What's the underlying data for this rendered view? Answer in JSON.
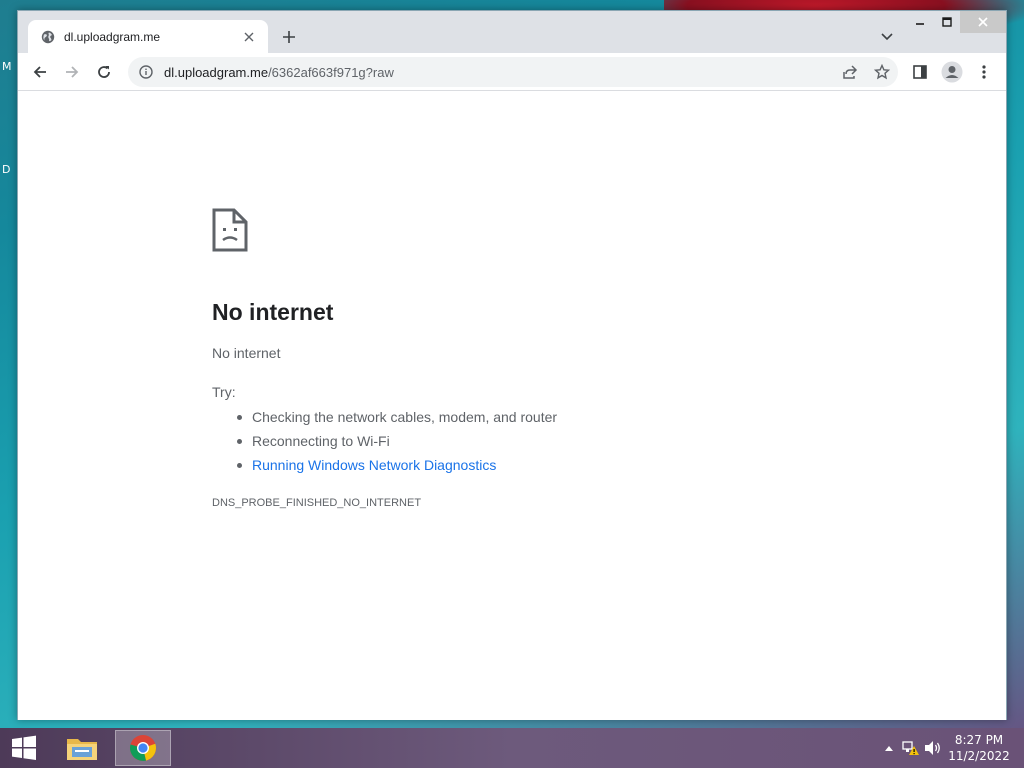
{
  "desktop": {
    "edge_text_1": "M",
    "edge_text_2": "D"
  },
  "window": {
    "controls": {
      "minimize": "—",
      "maximize": "☐",
      "close": "✕"
    }
  },
  "tabs": [
    {
      "title": "dl.uploadgram.me",
      "favicon": "globe-icon",
      "active": true
    }
  ],
  "toolbar": {
    "url_host": "dl.uploadgram.me",
    "url_path": "/6362af663f971g?raw"
  },
  "error_page": {
    "title": "No internet",
    "subtitle": "No internet",
    "try_label": "Try:",
    "suggestions": [
      "Checking the network cables, modem, and router",
      "Reconnecting to Wi-Fi",
      "Running Windows Network Diagnostics"
    ],
    "error_code": "DNS_PROBE_FINISHED_NO_INTERNET"
  },
  "taskbar": {
    "apps": [
      {
        "name": "File Explorer",
        "icon": "folder-icon"
      },
      {
        "name": "Google Chrome",
        "icon": "chrome-icon",
        "active": true
      }
    ],
    "clock_time": "8:27 PM",
    "clock_date": "11/2/2022"
  },
  "colors": {
    "link": "#1a73e8",
    "text_primary": "#202124",
    "text_secondary": "#5f6368",
    "tabstrip": "#dee1e6"
  }
}
